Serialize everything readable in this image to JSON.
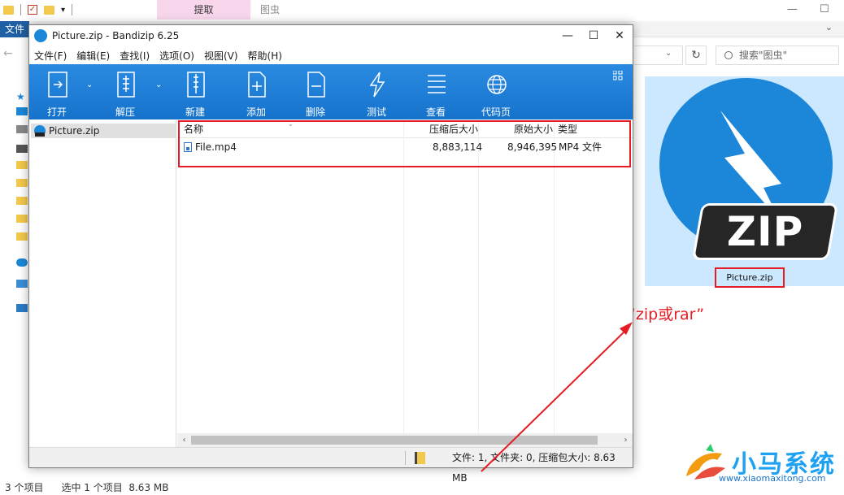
{
  "explorer": {
    "context_tab": "提取",
    "window_title": "图虫",
    "file_tab": "文件",
    "search_placeholder": "搜索\"图虫\"",
    "status_items": "3 个项目",
    "status_selected": "选中 1 个项目",
    "status_size": "8.63 MB",
    "thumbnail_caption": "Picture.zip",
    "thumbnail_badge": "ZIP"
  },
  "annotation": "扩展名改为 “zip或rar”",
  "watermark": {
    "title": "小马系统",
    "url": "www.xiaomaxitong.com"
  },
  "window": {
    "title": "Picture.zip - Bandizip 6.25",
    "menu": [
      "文件(F)",
      "编辑(E)",
      "查找(I)",
      "选项(O)",
      "视图(V)",
      "帮助(H)"
    ],
    "toolbar": [
      "打开",
      "解压",
      "新建",
      "添加",
      "删除",
      "测试",
      "查看",
      "代码页"
    ],
    "tree_item": "Picture.zip",
    "columns": {
      "name": "名称",
      "packed": "压缩后大小",
      "original": "原始大小",
      "type": "类型"
    },
    "files": [
      {
        "name": "File.mp4",
        "packed": "8,883,114",
        "original": "8,946,395",
        "type": "MP4 文件"
      }
    ],
    "status": "文件: 1, 文件夹: 0, 压缩包大小: 8.63 MB"
  },
  "colors": {
    "toolbar_blue": "#1c7fd8",
    "highlight_red": "#e51c23",
    "selection_blue": "#cce8ff"
  }
}
